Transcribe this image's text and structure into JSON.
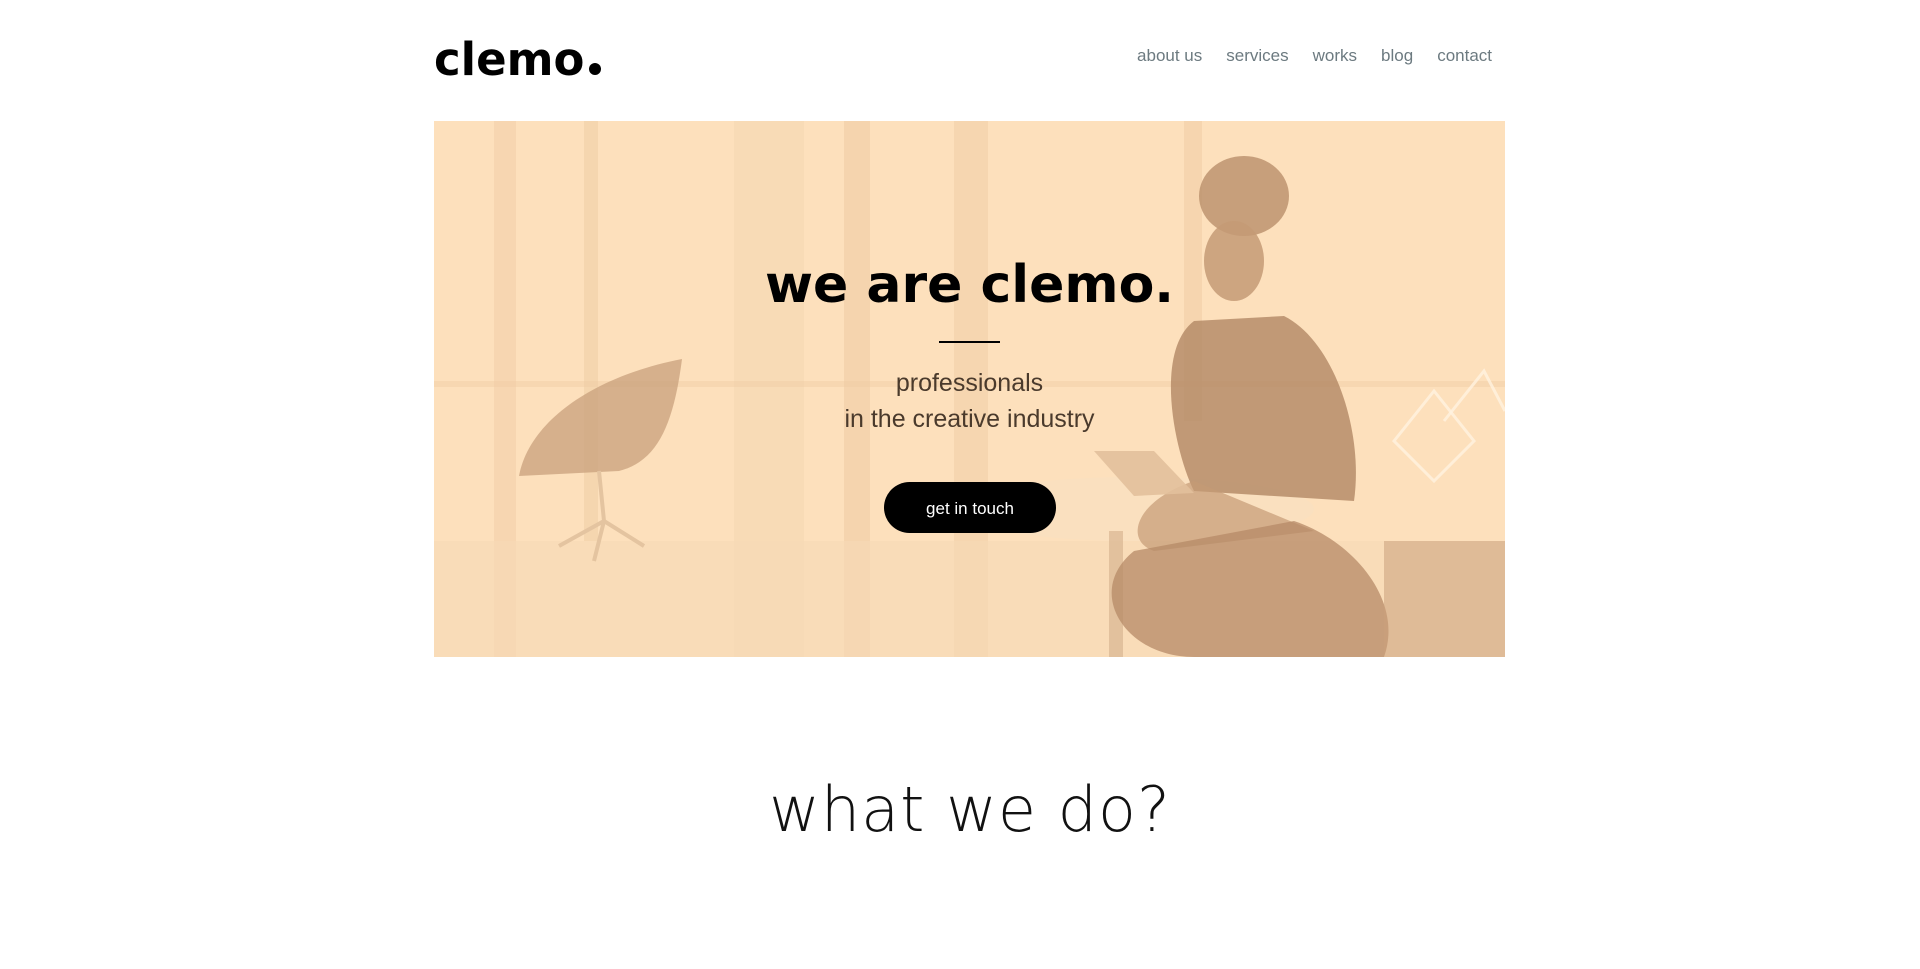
{
  "brand": {
    "logo_text": "clemo"
  },
  "nav": {
    "items": [
      {
        "label": "about us"
      },
      {
        "label": "services"
      },
      {
        "label": "works"
      },
      {
        "label": "blog"
      },
      {
        "label": "contact"
      }
    ]
  },
  "hero": {
    "title": "we are clemo.",
    "subtitle_line1": "professionals",
    "subtitle_line2": "in the creative industry",
    "cta_label": "get in touch",
    "tint_color": "#fde0bc"
  },
  "section": {
    "title": "what we do?"
  }
}
